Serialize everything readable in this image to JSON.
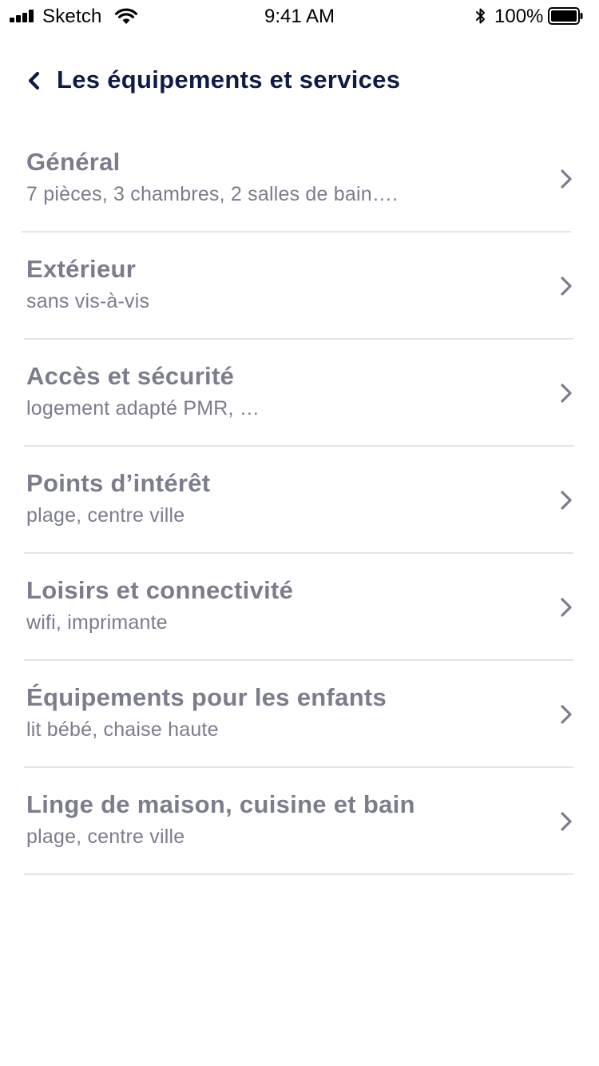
{
  "status_bar": {
    "carrier": "Sketch",
    "time": "9:41 AM",
    "battery_percent": "100%",
    "signal_bars": 4,
    "icons": [
      "signal-icon",
      "wifi-icon",
      "bluetooth-icon",
      "battery-icon"
    ]
  },
  "header": {
    "back_icon": "chevron-left-icon",
    "title": "Les équipements et services"
  },
  "colors": {
    "title": "#0f1b47",
    "item_text": "#7b7c8c",
    "divider": "#e4e4e8",
    "chevron": "#7b7c8c"
  },
  "list": {
    "items": [
      {
        "title": "Général",
        "subtitle": "7 pièces, 3 chambres, 2 salles de bain…."
      },
      {
        "title": "Extérieur",
        "subtitle": "sans vis-à-vis"
      },
      {
        "title": "Accès et sécurité",
        "subtitle": "logement adapté PMR, …"
      },
      {
        "title": "Points d’intérêt",
        "subtitle": "plage, centre ville"
      },
      {
        "title": "Loisirs et connectivité",
        "subtitle": "wifi, imprimante"
      },
      {
        "title": "Équipements pour les enfants",
        "subtitle": "lit bébé, chaise haute"
      },
      {
        "title": "Linge de maison, cuisine et bain",
        "subtitle": "plage, centre ville"
      }
    ]
  }
}
